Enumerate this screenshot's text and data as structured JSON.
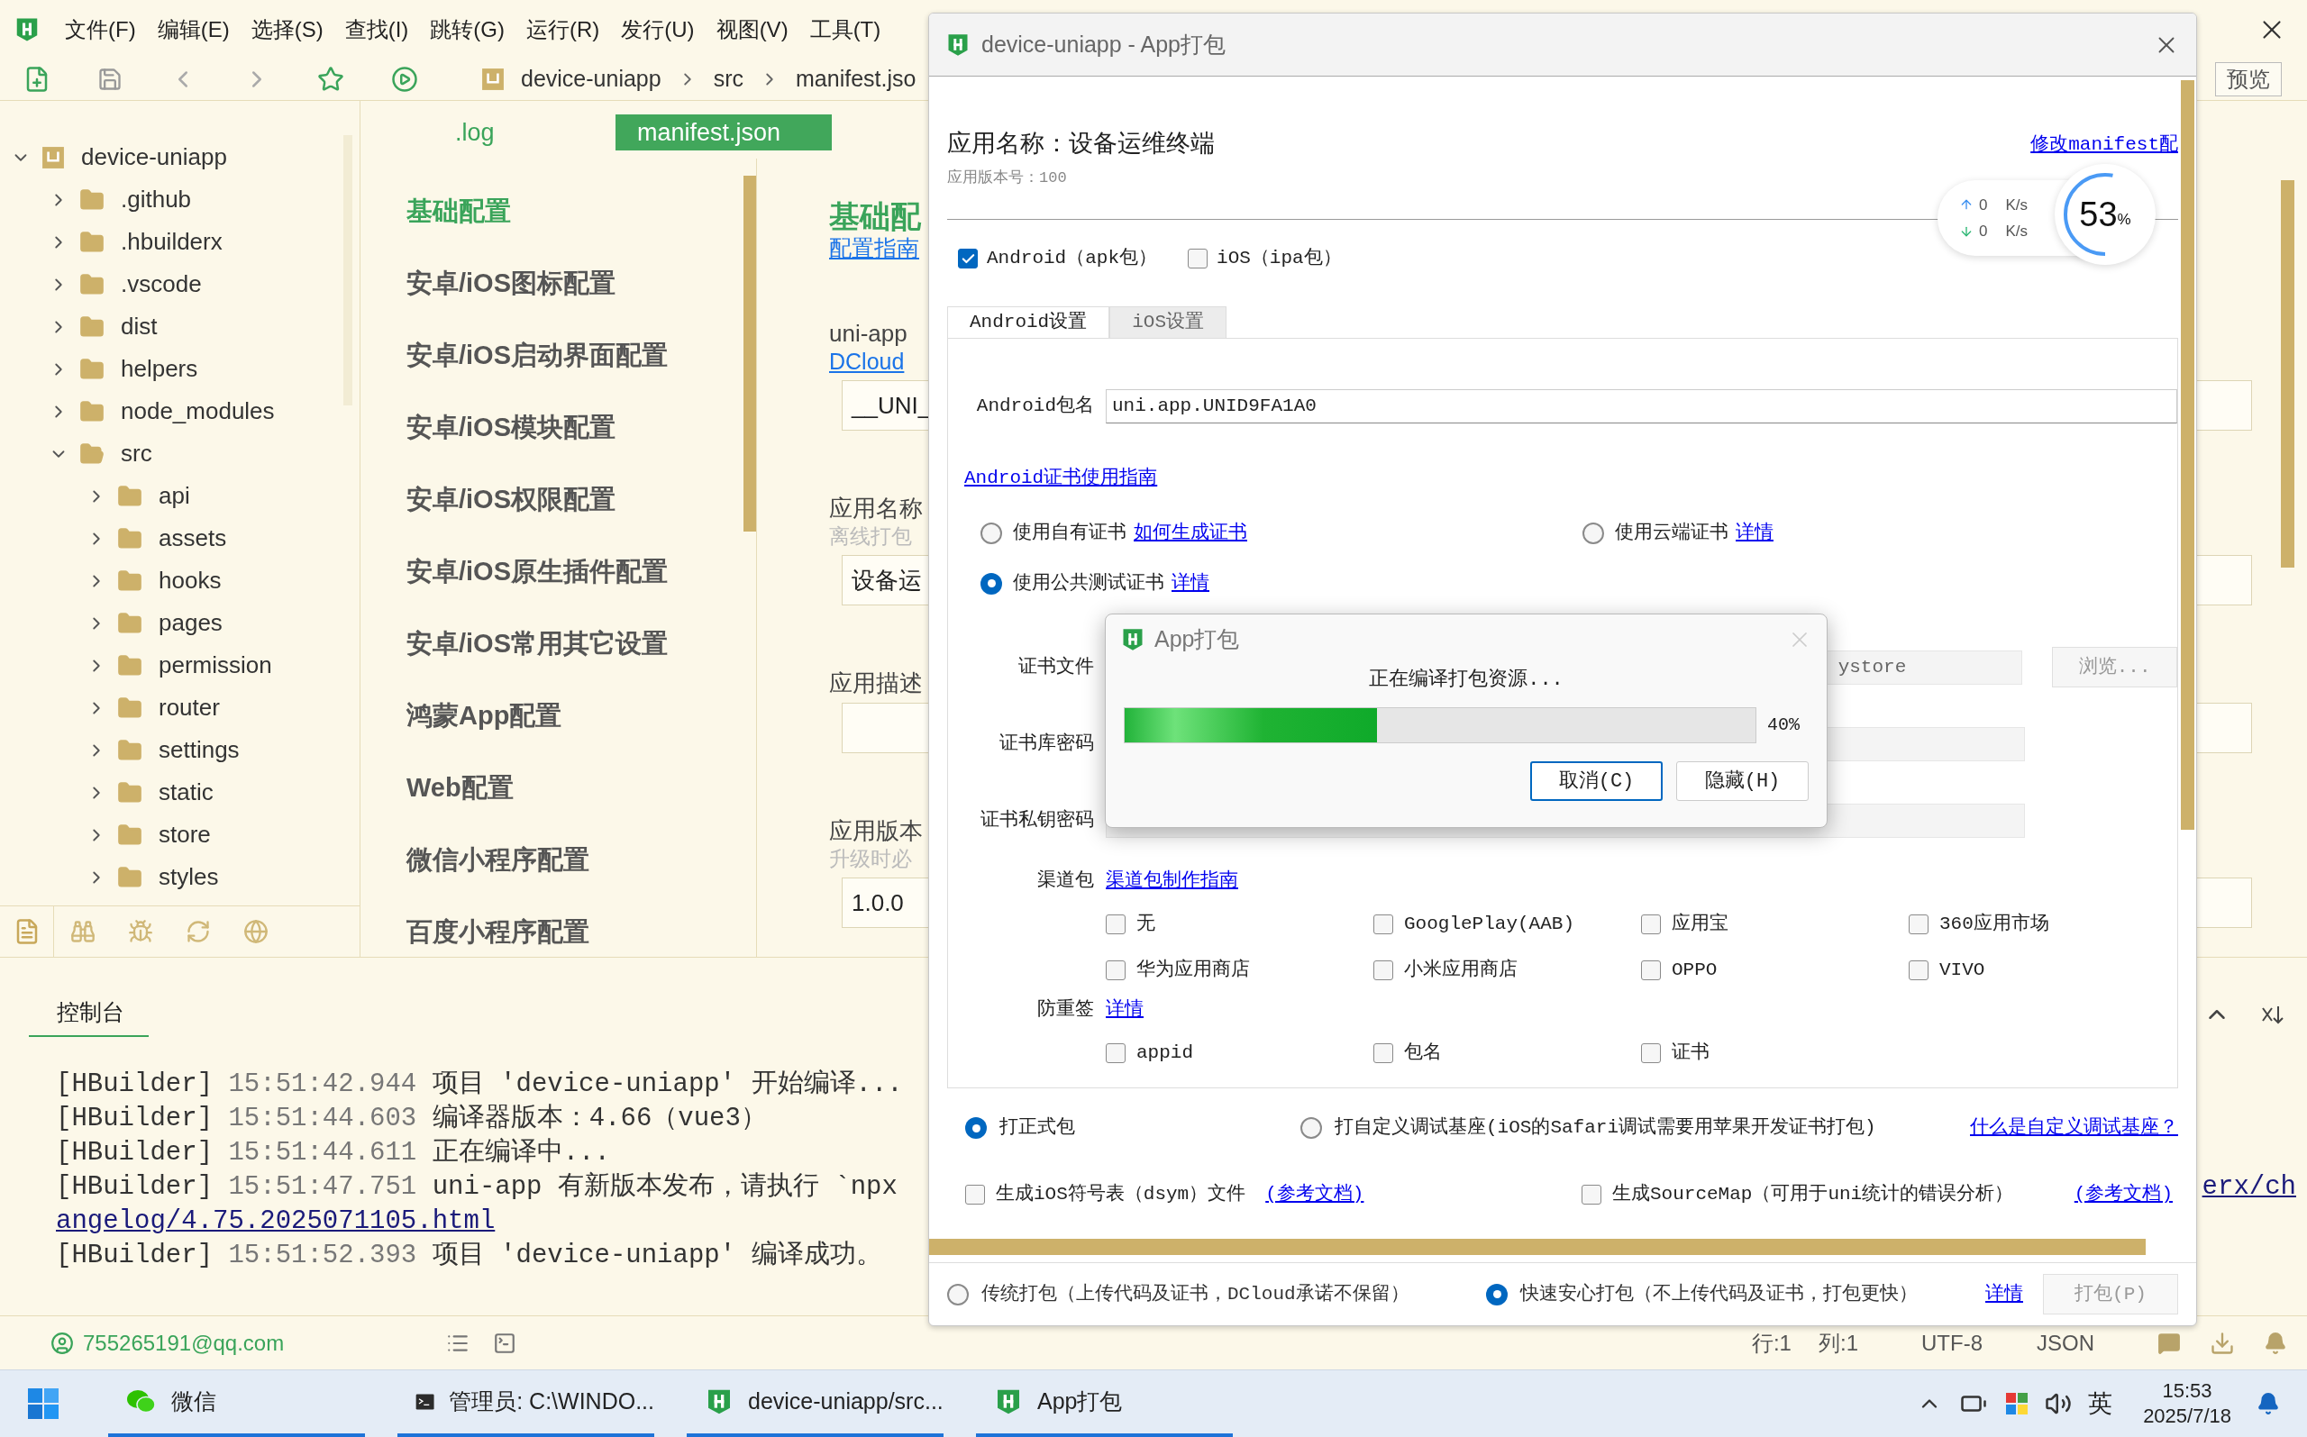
{
  "menu_bar": {
    "items": [
      "文件(F)",
      "编辑(E)",
      "选择(S)",
      "查找(I)",
      "跳转(G)",
      "运行(R)",
      "发行(U)",
      "视图(V)",
      "工具(T)"
    ]
  },
  "toolbar": {
    "breadcrumb": [
      "device-uniapp",
      "src",
      "manifest.jso"
    ],
    "preview_button": "预览"
  },
  "file_tree": [
    {
      "label": "device-uniapp",
      "kind": "project",
      "expanded": true,
      "children": [
        {
          "label": ".github",
          "kind": "folder",
          "expanded": false
        },
        {
          "label": ".hbuilderx",
          "kind": "folder",
          "expanded": false
        },
        {
          "label": ".vscode",
          "kind": "folder",
          "expanded": false
        },
        {
          "label": "dist",
          "kind": "folder",
          "expanded": false
        },
        {
          "label": "helpers",
          "kind": "folder",
          "expanded": false
        },
        {
          "label": "node_modules",
          "kind": "folder",
          "expanded": false
        },
        {
          "label": "src",
          "kind": "folder",
          "expanded": true,
          "children": [
            {
              "label": "api",
              "kind": "folder",
              "expanded": false
            },
            {
              "label": "assets",
              "kind": "folder",
              "expanded": false
            },
            {
              "label": "hooks",
              "kind": "folder",
              "expanded": false
            },
            {
              "label": "pages",
              "kind": "folder",
              "expanded": false
            },
            {
              "label": "permission",
              "kind": "folder",
              "expanded": false
            },
            {
              "label": "router",
              "kind": "folder",
              "expanded": false
            },
            {
              "label": "settings",
              "kind": "folder",
              "expanded": false
            },
            {
              "label": "static",
              "kind": "folder",
              "expanded": false
            },
            {
              "label": "store",
              "kind": "folder",
              "expanded": false
            },
            {
              "label": "styles",
              "kind": "folder",
              "expanded": false
            }
          ]
        }
      ]
    }
  ],
  "editor_tabs": [
    {
      "label": ".log",
      "selected": false
    },
    {
      "label": "manifest.json",
      "selected": true
    }
  ],
  "settings_nav": [
    {
      "label": "基础配置",
      "selected": true
    },
    {
      "label": "安卓/iOS图标配置",
      "selected": false
    },
    {
      "label": "安卓/iOS启动界面配置",
      "selected": false
    },
    {
      "label": "安卓/iOS模块配置",
      "selected": false
    },
    {
      "label": "安卓/iOS权限配置",
      "selected": false
    },
    {
      "label": "安卓/iOS原生插件配置",
      "selected": false
    },
    {
      "label": "安卓/iOS常用其它设置",
      "selected": false
    },
    {
      "label": "鸿蒙App配置",
      "selected": false
    },
    {
      "label": "Web配置",
      "selected": false
    },
    {
      "label": "微信小程序配置",
      "selected": false
    },
    {
      "label": "百度小程序配置",
      "selected": false
    }
  ],
  "editor": {
    "heading": "基础配",
    "guide_link": "配置指南",
    "fields": [
      {
        "label": "uni-app",
        "link": "DCloud",
        "value": "__UNI_"
      },
      {
        "label": "应用名称",
        "hint": "离线打包",
        "value": "设备运"
      },
      {
        "label": "应用描述"
      },
      {
        "label": "应用版本",
        "hint": "升级时必",
        "value": "1.0.0"
      }
    ]
  },
  "console": {
    "tab": "控制台",
    "lines": [
      {
        "kind": "log",
        "tag": "[HBuilder]",
        "time": "15:51:42.944",
        "message": "项目 'device-uniapp' 开始编译..."
      },
      {
        "kind": "log",
        "tag": "[HBuilder]",
        "time": "15:51:44.603",
        "message": "编译器版本：4.66（vue3）"
      },
      {
        "kind": "log",
        "tag": "[HBuilder]",
        "time": "15:51:44.611",
        "message": "正在编译中..."
      },
      {
        "kind": "log",
        "tag": "[HBuilder]",
        "time": "15:51:47.751",
        "message": "uni-app 有新版本发布，请执行 `npx",
        "tail": "erx/ch"
      },
      {
        "kind": "link",
        "text": "angelog/4.75.2025071105.html"
      },
      {
        "kind": "log",
        "tag": "[HBuilder]",
        "time": "15:51:52.393",
        "message": "项目 'device-uniapp' 编译成功。"
      }
    ]
  },
  "status_bar": {
    "account": "755265191@qq.com",
    "position": [
      "行:1",
      "列:1"
    ],
    "encoding": "UTF-8",
    "language": "JSON"
  },
  "taskbar": {
    "apps": [
      {
        "label": "微信",
        "kind": "wechat"
      },
      {
        "label": "管理员: C:\\WINDO...",
        "kind": "terminal"
      },
      {
        "label": "device-uniapp/src...",
        "kind": "hbuilder"
      },
      {
        "label": "App打包",
        "kind": "hbuilder"
      }
    ],
    "ime": "英",
    "time": "15:53",
    "date": "2025/7/18"
  },
  "dialog": {
    "title": "device-uniapp - App打包",
    "app_name": "应用名称：设备运维终端",
    "version": "应用版本号：100",
    "manifest_link": "修改manifest配",
    "network": {
      "up": "0",
      "up_unit": "K/s",
      "down": "0",
      "down_unit": "K/s",
      "percent": "53",
      "percent_unit": "%",
      "level": 0.53
    },
    "platforms": [
      {
        "label": "Android（apk包）",
        "checked": true
      },
      {
        "label": "iOS（ipa包）",
        "checked": false
      }
    ],
    "tabs": [
      {
        "label": "Android设置",
        "selected": true
      },
      {
        "label": "iOS设置",
        "selected": false
      }
    ],
    "package_name": {
      "label": "Android包名",
      "value": "uni.app.UNID9FA1A0"
    },
    "cert_guide_link": "Android证书使用指南",
    "cert_options": [
      {
        "label": "使用自有证书",
        "link": "如何生成证书",
        "selected": false
      },
      {
        "label": "使用云端证书",
        "link": "详情",
        "selected": false
      },
      {
        "label": "使用公共测试证书",
        "link": "详情",
        "selected": true
      }
    ],
    "cert_fields": [
      {
        "label": "证书文件",
        "value": "ystore"
      },
      {
        "label": "证书库密码"
      },
      {
        "label": "证书私钥密码"
      }
    ],
    "browse_button": {
      "label": "浏览...",
      "disabled": true
    },
    "channels": {
      "label": "渠道包",
      "link": "渠道包制作指南",
      "options": [
        {
          "label": "无",
          "checked": false
        },
        {
          "label": "GooglePlay(AAB)",
          "checked": false
        },
        {
          "label": "应用宝",
          "checked": false
        },
        {
          "label": "360应用市场",
          "checked": false
        },
        {
          "label": "华为应用商店",
          "checked": false
        },
        {
          "label": "小米应用商店",
          "checked": false
        },
        {
          "label": "OPPO",
          "checked": false
        },
        {
          "label": "VIVO",
          "checked": false
        }
      ]
    },
    "anti_resign": {
      "label": "防重签",
      "link": "详情",
      "options": [
        {
          "label": "appid",
          "checked": false
        },
        {
          "label": "包名",
          "checked": false
        },
        {
          "label": "证书",
          "checked": false
        }
      ]
    },
    "build_types": [
      {
        "label": "打正式包",
        "selected": true
      },
      {
        "label": "打自定义调试基座(iOS的Safari调试需要用苹果开发证书打包)",
        "selected": false
      }
    ],
    "build_type_link": "什么是自定义调试基座？",
    "extras": [
      {
        "label": "生成iOS符号表（dsym）文件",
        "link": "(参考文档)",
        "checked": false
      },
      {
        "label": "生成SourceMap（可用于uni统计的错误分析）",
        "link": "(参考文档)",
        "checked": false
      }
    ],
    "modes": [
      {
        "label": "传统打包（上传代码及证书，DCloud承诺不保留）",
        "selected": false
      },
      {
        "label": "快速安心打包（不上传代码及证书，打包更快）",
        "selected": true
      }
    ],
    "mode_link": "详情",
    "build_button": {
      "label": "打包(P)",
      "disabled": true
    }
  },
  "progress_dialog": {
    "title": "App打包",
    "message": "正在编译打包资源...",
    "level": 0.4,
    "reading": "40%",
    "buttons": [
      {
        "label": "取消(C)",
        "focused": true
      },
      {
        "label": "隐藏(H)",
        "focused": false
      }
    ]
  }
}
